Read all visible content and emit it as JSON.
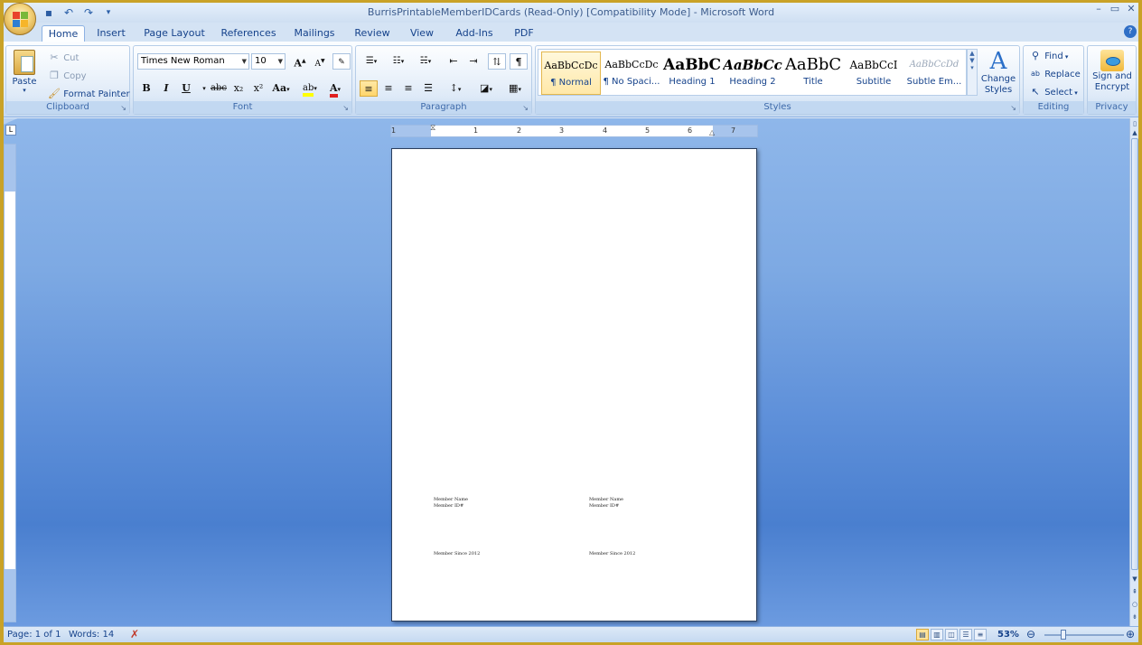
{
  "window": {
    "title": "BurrisPrintableMemberIDCards (Read-Only) [Compatibility Mode] - Microsoft Word",
    "controls": [
      "–",
      "▭",
      "✕"
    ]
  },
  "quick_access": [
    "save-icon",
    "undo-icon",
    "redo-icon",
    "customize-icon"
  ],
  "tabs": [
    "Home",
    "Insert",
    "Page Layout",
    "References",
    "Mailings",
    "Review",
    "View",
    "Add-Ins",
    "PDF"
  ],
  "active_tab": "Home",
  "ribbon": {
    "clipboard": {
      "label": "Clipboard",
      "paste": "Paste",
      "cut": "Cut",
      "copy": "Copy",
      "format_painter": "Format Painter"
    },
    "font": {
      "label": "Font",
      "font_name": "Times New Roman",
      "font_size": "10",
      "bold": "B",
      "italic": "I",
      "underline": "U",
      "strike": "abc",
      "subscript": "x₂",
      "superscript": "x²",
      "change_case": "Aa",
      "grow": "A",
      "shrink": "A",
      "highlight": "ab",
      "font_color": "A",
      "highlight_color": "#ffff00",
      "font_color_value": "#e02020"
    },
    "paragraph": {
      "label": "Paragraph",
      "show_marks": "¶"
    },
    "styles": {
      "label": "Styles",
      "items": [
        {
          "sample": "AaBbCcDc",
          "name": "¶ Normal"
        },
        {
          "sample": "AaBbCcDc",
          "name": "¶ No Spaci..."
        },
        {
          "sample": "AaBbC",
          "name": "Heading 1"
        },
        {
          "sample": "AaBbCc",
          "name": "Heading 2"
        },
        {
          "sample": "AaBbC",
          "name": "Title"
        },
        {
          "sample": "AaBbCcI",
          "name": "Subtitle"
        },
        {
          "sample": "AaBbCcDd",
          "name": "Subtle Em..."
        }
      ],
      "change_styles": "Change Styles"
    },
    "editing": {
      "label": "Editing",
      "find": "Find",
      "replace": "Replace",
      "select": "Select"
    },
    "privacy": {
      "label": "Privacy",
      "sign_encrypt": "Sign and Encrypt"
    }
  },
  "document": {
    "cards": [
      {
        "name_label": "Member Name",
        "id_label": "Member ID#",
        "since": "Member Since 2012"
      },
      {
        "name_label": "Member Name",
        "id_label": "Member ID#",
        "since": "Member Since 2012"
      }
    ]
  },
  "ruler": {
    "marks": [
      "1",
      "1",
      "2",
      "3",
      "4",
      "5",
      "6",
      "7"
    ]
  },
  "status": {
    "page": "Page: 1 of 1",
    "words": "Words: 14",
    "zoom": "53%"
  }
}
